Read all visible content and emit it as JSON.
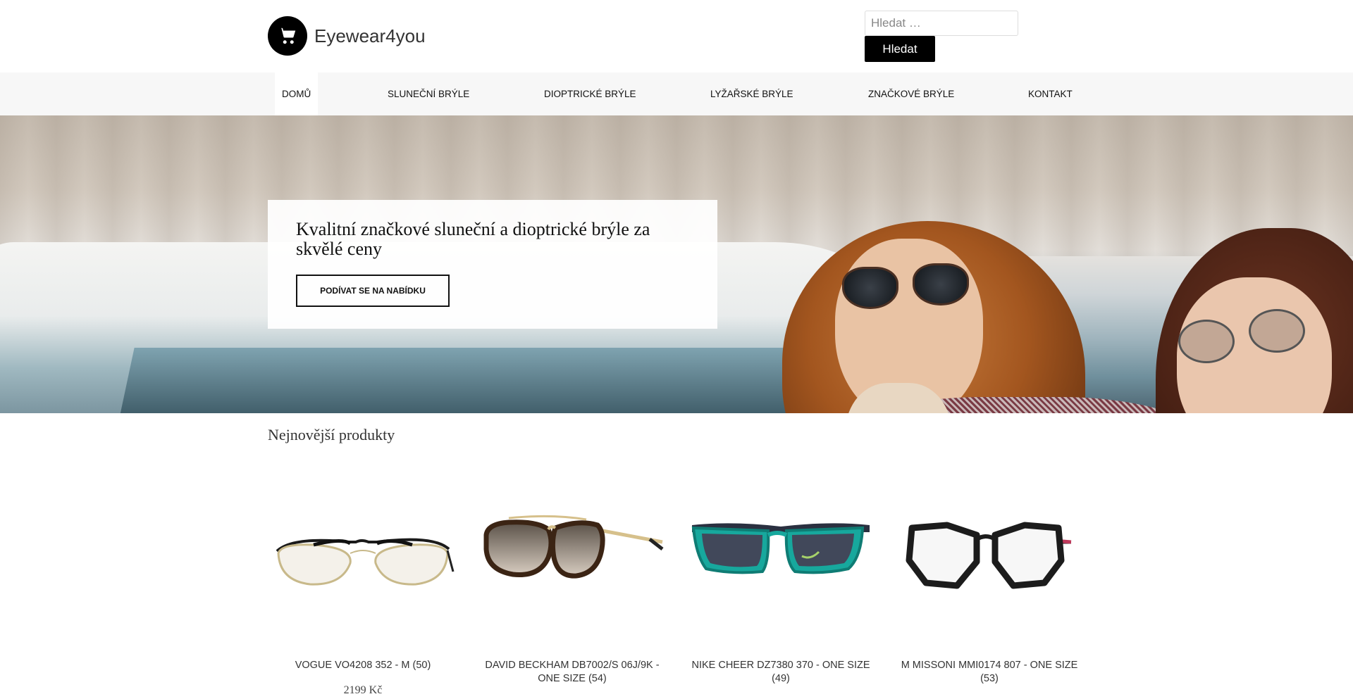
{
  "header": {
    "site_title": "Eyewear4you",
    "logo_icon": "cart-icon",
    "search": {
      "placeholder": "Hledat …",
      "button_label": "Hledat"
    }
  },
  "nav": {
    "items": [
      {
        "label": "Domů",
        "active": true
      },
      {
        "label": "Sluneční brýle"
      },
      {
        "label": "Dioptrické brýle"
      },
      {
        "label": "Lyžařské brýle"
      },
      {
        "label": "Značkové brýle"
      },
      {
        "label": "Kontakt"
      }
    ]
  },
  "hero": {
    "heading": "Kvalitní značkové sluneční a dioptrické brýle za skvělé ceny",
    "button_label": "Podívat se na nabídku"
  },
  "products": {
    "title": "Nejnovější produkty",
    "items": [
      {
        "name": "VOGUE VO4208 352 - M (50)",
        "price": "2199 Kč"
      },
      {
        "name": "DAVID BECKHAM DB7002/S 06J/9K - ONE SIZE (54)"
      },
      {
        "name": "NIKE CHEER DZ7380 370 - ONE SIZE (49)"
      },
      {
        "name": "M MISSONI MMI0174 807 - ONE SIZE (53)"
      }
    ]
  }
}
